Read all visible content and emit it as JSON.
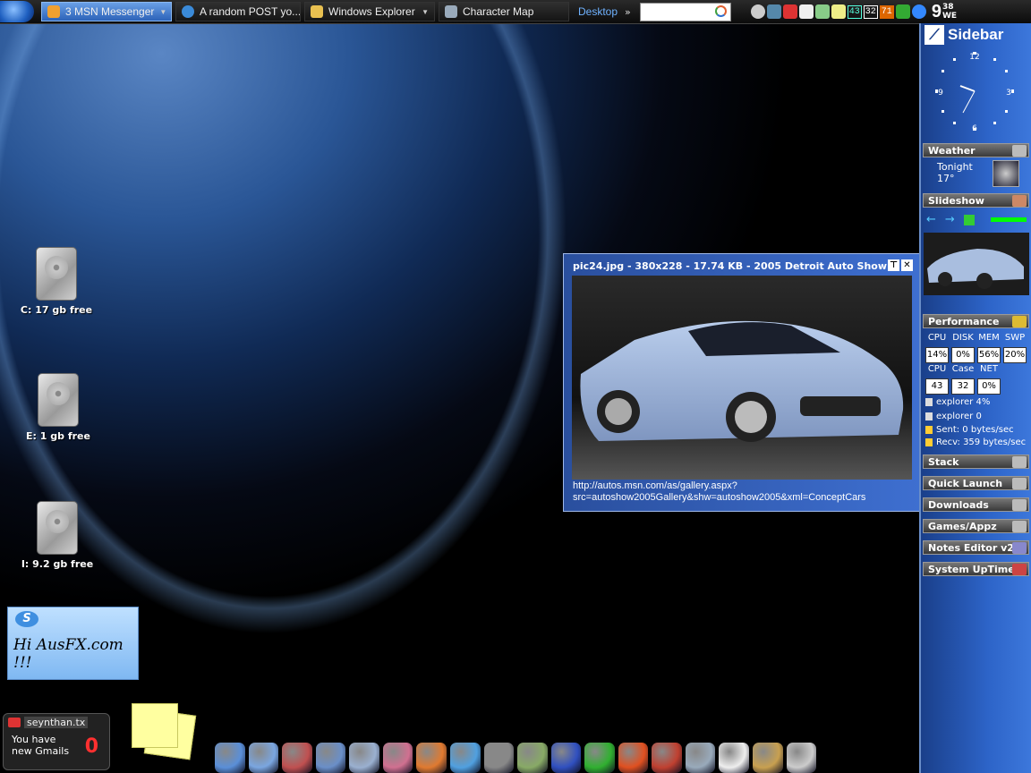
{
  "taskbar": {
    "tasks": [
      {
        "label": "3 MSN Messenger",
        "active": true
      },
      {
        "label": "A random POST yo...",
        "active": false
      },
      {
        "label": "Windows Explorer",
        "active": false
      },
      {
        "label": "Character Map",
        "active": false
      }
    ],
    "desktop_label": "Desktop",
    "tray_numbers": [
      "43",
      "32",
      "71"
    ],
    "clock": {
      "time": "9",
      "minutes": "38",
      "day": "WE"
    }
  },
  "desktop": {
    "drives": [
      {
        "label": "C: 17 gb free"
      },
      {
        "label": "E: 1 gb free"
      },
      {
        "label": "I: 9.2 gb free"
      }
    ],
    "note_text": "Hi AusFX.com !!!",
    "gmail": {
      "user": "seynthan.tx",
      "line1": "You have",
      "line2": "new Gmails",
      "count": "0"
    },
    "dock_icons": [
      "computer-icon",
      "folder-icon",
      "media-icon",
      "music-folder-icon",
      "documents-icon",
      "pictures-icon",
      "firefox-icon",
      "messenger-icon",
      "trash-icon",
      "photo-icon",
      "vlc-icon",
      "green-app-icon",
      "network-icon",
      "game-icon",
      "compass-icon",
      "editor-icon",
      "paint-icon",
      "weather-icon"
    ]
  },
  "popup": {
    "title": "pic24.jpg - 380x228 - 17.74 KB - 2005 Detroit Auto Show",
    "url_line1": "http://autos.msn.com/as/gallery.aspx?",
    "url_line2": "src=autoshow2005Gallery&shw=autoshow2005&xml=ConceptCars"
  },
  "sidebar": {
    "title": "Sidebar",
    "clock_labels": {
      "n12": "12",
      "n3": "3",
      "n6": "6",
      "n9": "9"
    },
    "weather": {
      "bar": "Weather",
      "line1": "Tonight",
      "line2": "17°"
    },
    "slideshow": {
      "bar": "Slideshow"
    },
    "performance": {
      "bar": "Performance",
      "row1_labels": [
        "CPU",
        "DISK",
        "MEM",
        "SWP"
      ],
      "row1_values": [
        "14%",
        "0%",
        "56%",
        "20%"
      ],
      "row2_labels": [
        "CPU",
        "Case",
        "NET"
      ],
      "row2_values": [
        "43",
        "32",
        "0%"
      ],
      "lines": [
        "explorer 4%",
        "explorer 0",
        "Sent: 0 bytes/sec",
        "Recv: 359 bytes/sec"
      ]
    },
    "gadgets": [
      "Stack",
      "Quick Launch",
      "Downloads",
      "Games/Appz",
      "Notes Editor v2",
      "System UpTime"
    ]
  }
}
